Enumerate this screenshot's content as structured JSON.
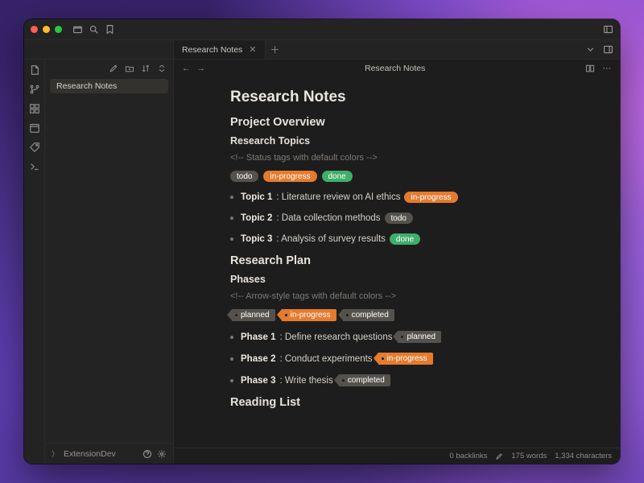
{
  "tab": {
    "title": "Research Notes"
  },
  "sidebar": {
    "file": "Research Notes",
    "workspace": "ExtensionDev"
  },
  "editor": {
    "breadcrumb": "Research Notes"
  },
  "doc": {
    "h1": "Research Notes",
    "overview_h2": "Project Overview",
    "topics_h3": "Research Topics",
    "topics_comment": "<!-- Status tags with default colors -->",
    "tags": {
      "todo": "todo",
      "inprogress": "in-progress",
      "done": "done"
    },
    "topics": [
      {
        "label": "Topic 1",
        "text": ": Literature review on AI ethics ",
        "tag": "in-progress",
        "cls": "orange"
      },
      {
        "label": "Topic 2",
        "text": ": Data collection methods ",
        "tag": "todo",
        "cls": "gray"
      },
      {
        "label": "Topic 3",
        "text": ": Analysis of survey results ",
        "tag": "done",
        "cls": "green"
      }
    ],
    "plan_h2": "Research Plan",
    "phases_h3": "Phases",
    "phases_comment": "<!-- Arrow-style tags with default colors -->",
    "atags": {
      "planned": "planned",
      "inprogress": "in-progress",
      "completed": "completed"
    },
    "phases": [
      {
        "label": "Phase 1",
        "text": ": Define research questions ",
        "tag": "planned",
        "cls": "gray"
      },
      {
        "label": "Phase 2",
        "text": ": Conduct experiments ",
        "tag": "in-progress",
        "cls": "orange"
      },
      {
        "label": "Phase 3",
        "text": ": Write thesis ",
        "tag": "completed",
        "cls": "gray"
      }
    ],
    "reading_h2": "Reading List"
  },
  "status": {
    "backlinks": "0 backlinks",
    "words": "175 words",
    "chars": "1,334 characters"
  }
}
